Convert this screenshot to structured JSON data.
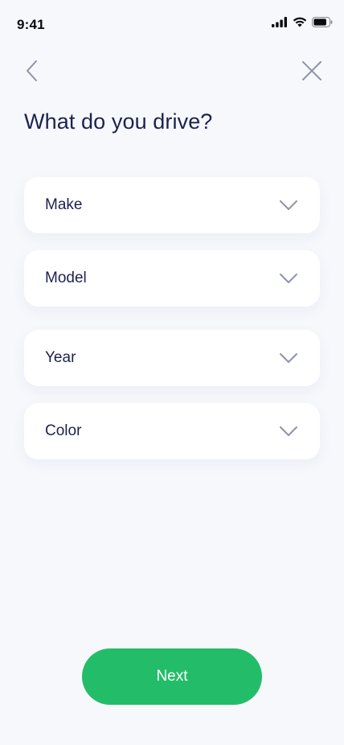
{
  "status_bar": {
    "time": "9:41",
    "icons": [
      "cellular-signal-icon",
      "wifi-icon",
      "battery-icon"
    ]
  },
  "nav": {
    "back_icon": "chevron-left-icon",
    "close_icon": "close-icon"
  },
  "title": "What do you drive?",
  "fields": [
    {
      "label": "Make",
      "icon": "chevron-down-icon"
    },
    {
      "label": "Model",
      "icon": "chevron-down-icon"
    },
    {
      "label": "Year",
      "icon": "chevron-down-icon"
    },
    {
      "label": "Color",
      "icon": "chevron-down-icon"
    }
  ],
  "next_button": {
    "label": "Next"
  },
  "colors": {
    "background": "#f7f8fc",
    "text_primary": "#1c2250",
    "icon_gray": "#8e93a6",
    "accent_green": "#23bd69",
    "card": "#ffffff"
  }
}
